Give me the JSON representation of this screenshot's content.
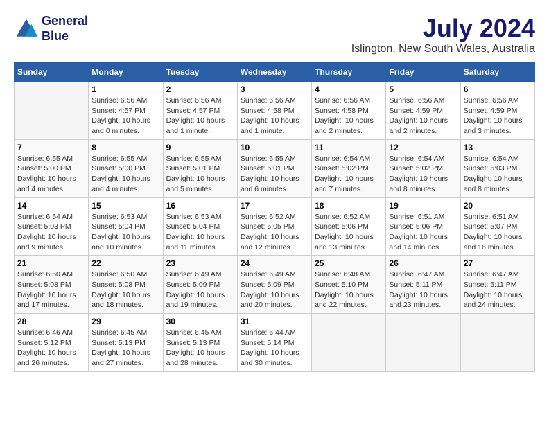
{
  "logo": {
    "line1": "General",
    "line2": "Blue"
  },
  "title": "July 2024",
  "subtitle": "Islington, New South Wales, Australia",
  "days_header": [
    "Sunday",
    "Monday",
    "Tuesday",
    "Wednesday",
    "Thursday",
    "Friday",
    "Saturday"
  ],
  "weeks": [
    [
      {
        "day": "",
        "info": ""
      },
      {
        "day": "1",
        "info": "Sunrise: 6:56 AM\nSunset: 4:57 PM\nDaylight: 10 hours\nand 0 minutes."
      },
      {
        "day": "2",
        "info": "Sunrise: 6:56 AM\nSunset: 4:57 PM\nDaylight: 10 hours\nand 1 minute."
      },
      {
        "day": "3",
        "info": "Sunrise: 6:56 AM\nSunset: 4:58 PM\nDaylight: 10 hours\nand 1 minute."
      },
      {
        "day": "4",
        "info": "Sunrise: 6:56 AM\nSunset: 4:58 PM\nDaylight: 10 hours\nand 2 minutes."
      },
      {
        "day": "5",
        "info": "Sunrise: 6:56 AM\nSunset: 4:59 PM\nDaylight: 10 hours\nand 2 minutes."
      },
      {
        "day": "6",
        "info": "Sunrise: 6:56 AM\nSunset: 4:59 PM\nDaylight: 10 hours\nand 3 minutes."
      }
    ],
    [
      {
        "day": "7",
        "info": "Sunrise: 6:55 AM\nSunset: 5:00 PM\nDaylight: 10 hours\nand 4 minutes."
      },
      {
        "day": "8",
        "info": "Sunrise: 6:55 AM\nSunset: 5:00 PM\nDaylight: 10 hours\nand 4 minutes."
      },
      {
        "day": "9",
        "info": "Sunrise: 6:55 AM\nSunset: 5:01 PM\nDaylight: 10 hours\nand 5 minutes."
      },
      {
        "day": "10",
        "info": "Sunrise: 6:55 AM\nSunset: 5:01 PM\nDaylight: 10 hours\nand 6 minutes."
      },
      {
        "day": "11",
        "info": "Sunrise: 6:54 AM\nSunset: 5:02 PM\nDaylight: 10 hours\nand 7 minutes."
      },
      {
        "day": "12",
        "info": "Sunrise: 6:54 AM\nSunset: 5:02 PM\nDaylight: 10 hours\nand 8 minutes."
      },
      {
        "day": "13",
        "info": "Sunrise: 6:54 AM\nSunset: 5:03 PM\nDaylight: 10 hours\nand 8 minutes."
      }
    ],
    [
      {
        "day": "14",
        "info": "Sunrise: 6:54 AM\nSunset: 5:03 PM\nDaylight: 10 hours\nand 9 minutes."
      },
      {
        "day": "15",
        "info": "Sunrise: 6:53 AM\nSunset: 5:04 PM\nDaylight: 10 hours\nand 10 minutes."
      },
      {
        "day": "16",
        "info": "Sunrise: 6:53 AM\nSunset: 5:04 PM\nDaylight: 10 hours\nand 11 minutes."
      },
      {
        "day": "17",
        "info": "Sunrise: 6:52 AM\nSunset: 5:05 PM\nDaylight: 10 hours\nand 12 minutes."
      },
      {
        "day": "18",
        "info": "Sunrise: 6:52 AM\nSunset: 5:06 PM\nDaylight: 10 hours\nand 13 minutes."
      },
      {
        "day": "19",
        "info": "Sunrise: 6:51 AM\nSunset: 5:06 PM\nDaylight: 10 hours\nand 14 minutes."
      },
      {
        "day": "20",
        "info": "Sunrise: 6:51 AM\nSunset: 5:07 PM\nDaylight: 10 hours\nand 16 minutes."
      }
    ],
    [
      {
        "day": "21",
        "info": "Sunrise: 6:50 AM\nSunset: 5:08 PM\nDaylight: 10 hours\nand 17 minutes."
      },
      {
        "day": "22",
        "info": "Sunrise: 6:50 AM\nSunset: 5:08 PM\nDaylight: 10 hours\nand 18 minutes."
      },
      {
        "day": "23",
        "info": "Sunrise: 6:49 AM\nSunset: 5:09 PM\nDaylight: 10 hours\nand 19 minutes."
      },
      {
        "day": "24",
        "info": "Sunrise: 6:49 AM\nSunset: 5:09 PM\nDaylight: 10 hours\nand 20 minutes."
      },
      {
        "day": "25",
        "info": "Sunrise: 6:48 AM\nSunset: 5:10 PM\nDaylight: 10 hours\nand 22 minutes."
      },
      {
        "day": "26",
        "info": "Sunrise: 6:47 AM\nSunset: 5:11 PM\nDaylight: 10 hours\nand 23 minutes."
      },
      {
        "day": "27",
        "info": "Sunrise: 6:47 AM\nSunset: 5:11 PM\nDaylight: 10 hours\nand 24 minutes."
      }
    ],
    [
      {
        "day": "28",
        "info": "Sunrise: 6:46 AM\nSunset: 5:12 PM\nDaylight: 10 hours\nand 26 minutes."
      },
      {
        "day": "29",
        "info": "Sunrise: 6:45 AM\nSunset: 5:13 PM\nDaylight: 10 hours\nand 27 minutes."
      },
      {
        "day": "30",
        "info": "Sunrise: 6:45 AM\nSunset: 5:13 PM\nDaylight: 10 hours\nand 28 minutes."
      },
      {
        "day": "31",
        "info": "Sunrise: 6:44 AM\nSunset: 5:14 PM\nDaylight: 10 hours\nand 30 minutes."
      },
      {
        "day": "",
        "info": ""
      },
      {
        "day": "",
        "info": ""
      },
      {
        "day": "",
        "info": ""
      }
    ]
  ]
}
